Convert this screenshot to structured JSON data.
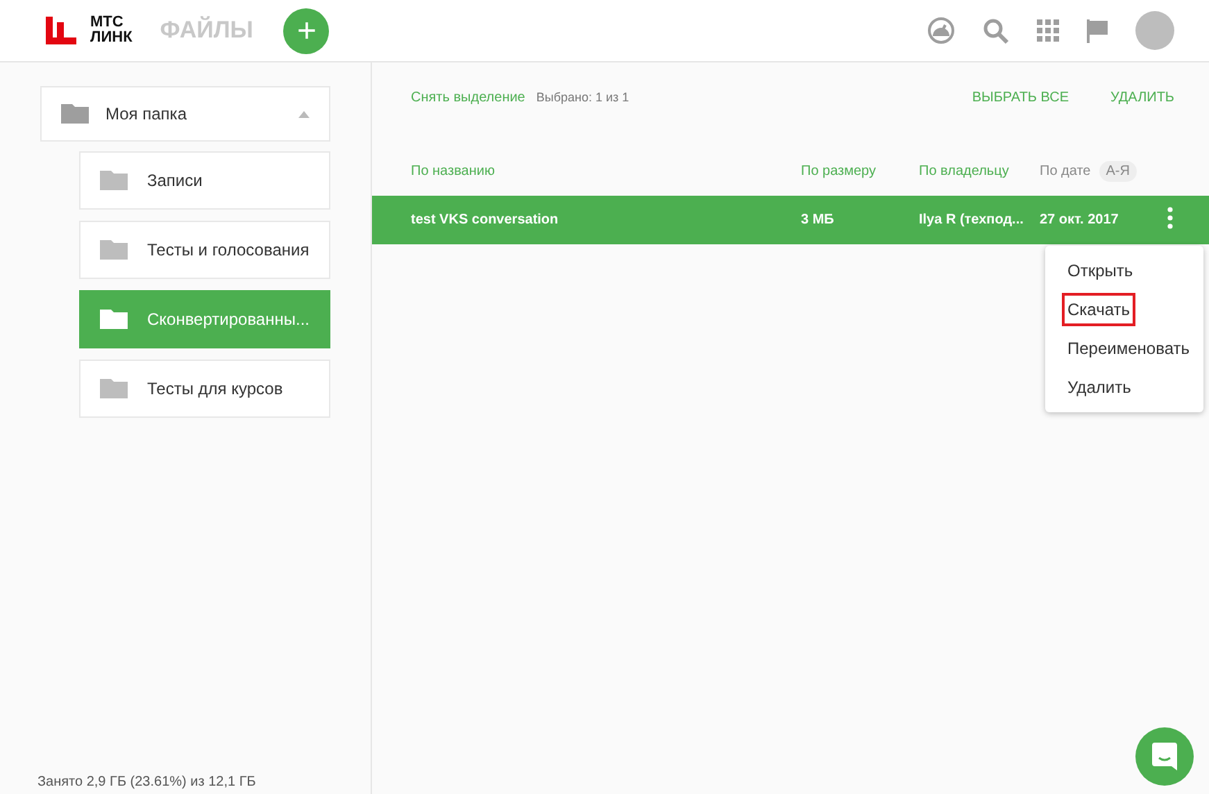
{
  "header": {
    "logo_line1": "МТС",
    "logo_line2": "ЛИНК",
    "section": "ФАЙЛЫ",
    "add_button": "+"
  },
  "sidebar": {
    "root": {
      "label": "Моя папка",
      "expanded": true,
      "children": [
        {
          "label": "Записи",
          "selected": false
        },
        {
          "label": "Тесты и голосования",
          "selected": false
        },
        {
          "label": "Сконвертированны...",
          "selected": true
        },
        {
          "label": "Тесты для курсов",
          "selected": false
        }
      ]
    },
    "storage": "Занято 2,9 ГБ (23.61%) из 12,1 ГБ"
  },
  "toolbar": {
    "deselect": "Снять выделение",
    "selected_count": "Выбрано: 1 из 1",
    "select_all": "ВЫБРАТЬ ВСЕ",
    "delete": "УДАЛИТЬ"
  },
  "table": {
    "columns": [
      {
        "label": "По названию",
        "selected": false
      },
      {
        "label": "По размеру",
        "selected": false
      },
      {
        "label": "По владельцу",
        "selected": false
      },
      {
        "label": "По дате",
        "selected": true
      }
    ],
    "sort_order": "А-Я",
    "rows": [
      {
        "name": "test VKS conversation",
        "size": "3 МБ",
        "owner": "Ilya R (техпод...",
        "date": "27 окт. 2017",
        "selected": true
      }
    ]
  },
  "context_menu": [
    {
      "label": "Открыть",
      "highlighted": false
    },
    {
      "label": "Скачать",
      "highlighted": true
    },
    {
      "label": "Переименовать",
      "highlighted": false
    },
    {
      "label": "Удалить",
      "highlighted": false
    }
  ]
}
